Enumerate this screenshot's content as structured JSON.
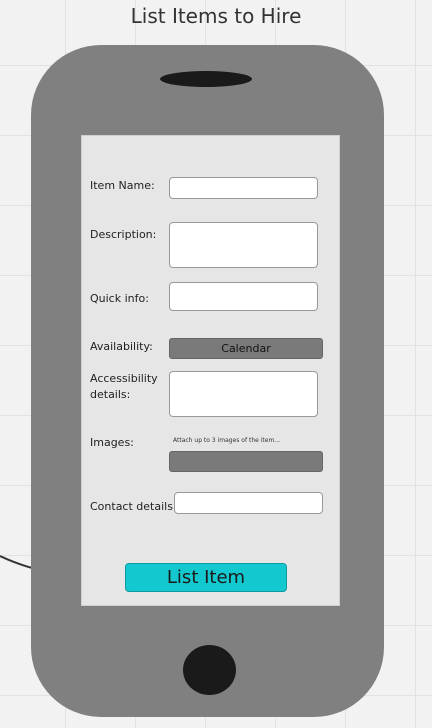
{
  "title": "List Items to Hire",
  "form": {
    "item_name_label": "Item Name:",
    "description_label": "Description:",
    "quick_info_label": "Quick info:",
    "availability_label": "Availability:",
    "calendar_button": "Calendar",
    "accessibility_label_line1": "Accessibility",
    "accessibility_label_line2": "details:",
    "images_label": "Images:",
    "images_hint": "Attach up to 3 images of the item...",
    "contact_label": "Contact details:",
    "submit_button": "List Item"
  },
  "colors": {
    "phone_body": "#808080",
    "screen": "#e6e6e6",
    "submit_button": "#14c8d0"
  }
}
